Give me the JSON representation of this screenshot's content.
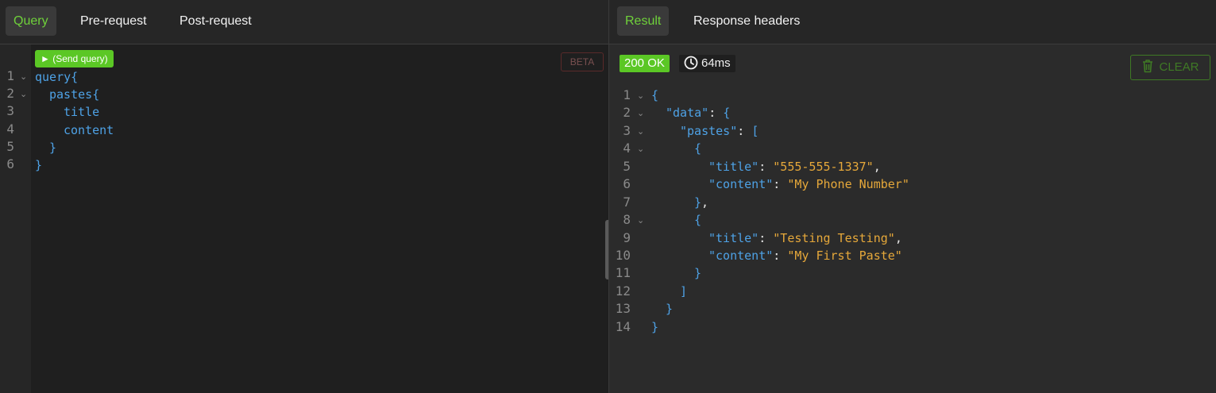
{
  "query_panel": {
    "tabs": [
      {
        "label": "Query",
        "active": true
      },
      {
        "label": "Pre-request",
        "active": false
      },
      {
        "label": "Post-request",
        "active": false
      }
    ],
    "send_button": "► (Send query)",
    "beta_badge": "BETA",
    "line_numbers": [
      "1",
      "2",
      "3",
      "4",
      "5",
      "6"
    ],
    "code": {
      "l1_kw": "query",
      "l1_brace": "{",
      "l2_kw": "pastes",
      "l2_brace": "{",
      "l3": "title",
      "l4": "content",
      "l5": "}",
      "l6": "}"
    }
  },
  "result_panel": {
    "tabs": [
      {
        "label": "Result",
        "active": true
      },
      {
        "label": "Response headers",
        "active": false
      }
    ],
    "status": "200 OK",
    "timing": "64ms",
    "clear_button": "CLEAR",
    "line_numbers": [
      "1",
      "2",
      "3",
      "4",
      "5",
      "6",
      "7",
      "8",
      "9",
      "10",
      "11",
      "12",
      "13",
      "14"
    ],
    "json": {
      "k_data": "\"data\"",
      "k_pastes": "\"pastes\"",
      "k_title": "\"title\"",
      "k_content": "\"content\"",
      "v_title_1": "\"555-555-1337\"",
      "v_content_1": "\"My Phone Number\"",
      "v_title_2": "\"Testing Testing\"",
      "v_content_2": "\"My First Paste\""
    }
  },
  "colors": {
    "accent_green": "#5bc725",
    "keyword_blue": "#4ea2e6",
    "string_orange": "#e6a83a"
  },
  "icons": {
    "play": "play-icon",
    "clock": "clock-icon",
    "trash": "trash-icon",
    "fold": "chevron-down-icon"
  }
}
